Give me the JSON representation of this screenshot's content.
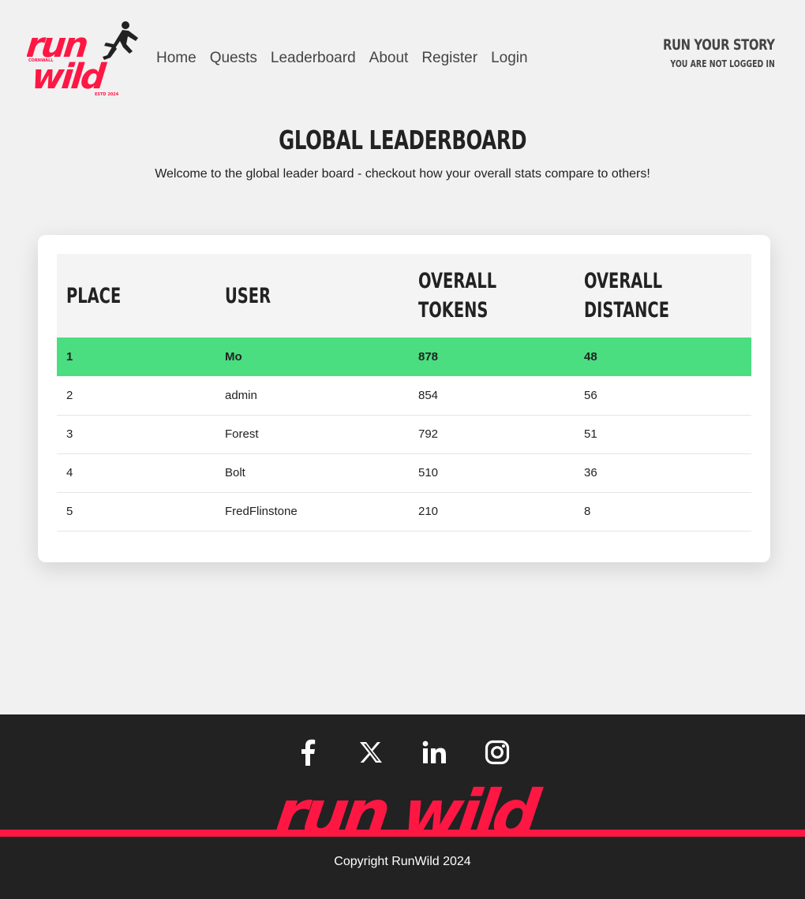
{
  "brand": {
    "name": "run wild",
    "logo_word_top": "run",
    "logo_word_bottom": "wild",
    "logo_region": "CORNWALL",
    "logo_estd": "ESTD 2024",
    "color": "#ff1744"
  },
  "nav": {
    "items": [
      {
        "label": "Home"
      },
      {
        "label": "Quests"
      },
      {
        "label": "Leaderboard"
      },
      {
        "label": "About"
      },
      {
        "label": "Register"
      },
      {
        "label": "Login"
      }
    ]
  },
  "header": {
    "tagline": "RUN YOUR STORY",
    "login_status": "YOU ARE NOT LOGGED IN"
  },
  "page": {
    "title": "GLOBAL LEADERBOARD",
    "subtitle": "Welcome to the global leader board - checkout how your overall stats compare to others!"
  },
  "leaderboard": {
    "columns": [
      "PLACE",
      "USER",
      "OVERALL TOKENS",
      "OVERALL DISTANCE"
    ],
    "rows": [
      {
        "place": "1",
        "user": "Mo",
        "tokens": "878",
        "distance": "48"
      },
      {
        "place": "2",
        "user": "admin",
        "tokens": "854",
        "distance": "56"
      },
      {
        "place": "3",
        "user": "Forest",
        "tokens": "792",
        "distance": "51"
      },
      {
        "place": "4",
        "user": "Bolt",
        "tokens": "510",
        "distance": "36"
      },
      {
        "place": "5",
        "user": "FredFlinstone",
        "tokens": "210",
        "distance": "8"
      }
    ],
    "highlight_color": "#4ade80"
  },
  "footer": {
    "socials": [
      "facebook-icon",
      "x-icon",
      "linkedin-icon",
      "instagram-icon"
    ],
    "brand_text": "run wild",
    "copyright": "Copyright RunWild 2024",
    "background": "#222222"
  }
}
